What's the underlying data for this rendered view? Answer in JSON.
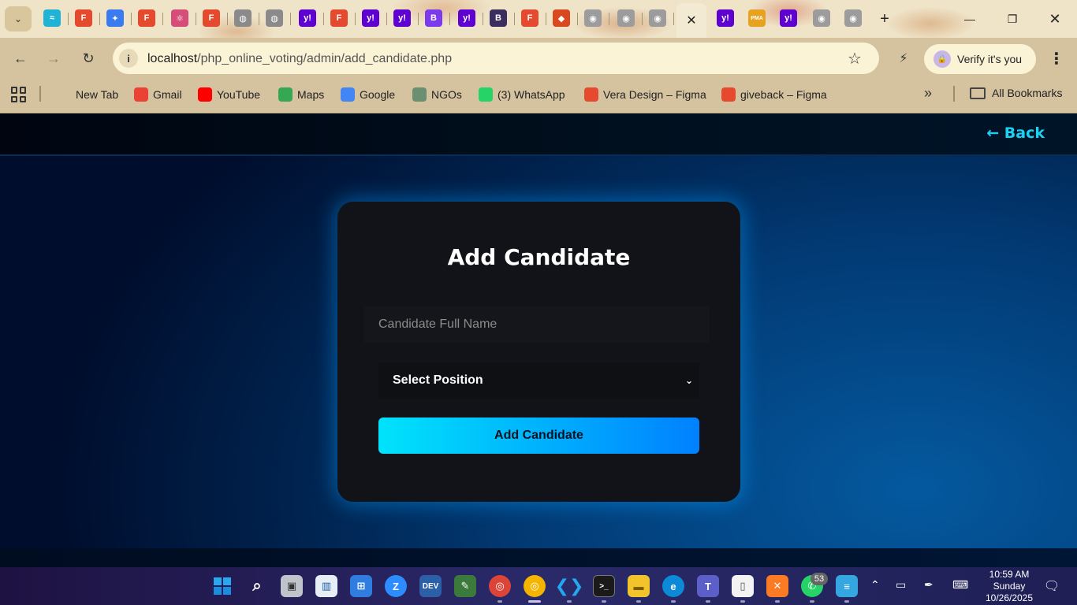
{
  "browser": {
    "pinned_tabs": [
      {
        "icon": "tailwind-icon",
        "glyph": "≈",
        "color": "#21b3d6"
      },
      {
        "icon": "figma-icon",
        "glyph": "F",
        "color": "#e64a2e"
      },
      {
        "icon": "gemini-icon",
        "glyph": "✦",
        "color": "#3a7bf0"
      },
      {
        "icon": "figma-icon",
        "glyph": "F",
        "color": "#e64a2e"
      },
      {
        "icon": "react-icon",
        "glyph": "⚛",
        "color": "#d64d7a"
      },
      {
        "icon": "figma-icon",
        "glyph": "F",
        "color": "#e64a2e"
      },
      {
        "icon": "globe-icon",
        "glyph": "◍",
        "color": "#8a8a8a"
      },
      {
        "icon": "globe-icon",
        "glyph": "◍",
        "color": "#8a8a8a"
      },
      {
        "icon": "yahoo-icon",
        "glyph": "y!",
        "color": "#5f01d1"
      },
      {
        "icon": "figma-icon",
        "glyph": "F",
        "color": "#e64a2e"
      },
      {
        "icon": "yahoo-icon",
        "glyph": "y!",
        "color": "#5f01d1"
      },
      {
        "icon": "yahoo-icon",
        "glyph": "y!",
        "color": "#5f01d1"
      },
      {
        "icon": "bootstrap-icon",
        "glyph": "B",
        "color": "#7c3aed"
      },
      {
        "icon": "yahoo-icon",
        "glyph": "y!",
        "color": "#5f01d1"
      },
      {
        "icon": "bootstrap-icon",
        "glyph": "B",
        "color": "#3b2d5e"
      },
      {
        "icon": "figma-icon",
        "glyph": "F",
        "color": "#e64a2e"
      },
      {
        "icon": "brave-icon",
        "glyph": "◆",
        "color": "#d9481f"
      },
      {
        "icon": "github-icon",
        "glyph": "◉",
        "color": "#9c9c9c"
      },
      {
        "icon": "github-icon",
        "glyph": "◉",
        "color": "#9c9c9c"
      },
      {
        "icon": "github-icon",
        "glyph": "◉",
        "color": "#9c9c9c"
      }
    ],
    "after_tabs": [
      {
        "icon": "yahoo-icon",
        "glyph": "y!",
        "color": "#5f01d1"
      },
      {
        "icon": "phpmyadmin-icon",
        "glyph": "PMA",
        "color": "#e7a320"
      },
      {
        "icon": "yahoo-icon",
        "glyph": "y!",
        "color": "#5f01d1"
      },
      {
        "icon": "github-icon",
        "glyph": "◉",
        "color": "#9c9c9c"
      },
      {
        "icon": "github-icon",
        "glyph": "◉",
        "color": "#9c9c9c"
      }
    ],
    "url_host": "localhost",
    "url_path": "/php_online_voting/admin/add_candidate.php",
    "profile_label": "Verify it's you",
    "bookmarks": [
      {
        "label": "New Tab",
        "icon": "none",
        "color": ""
      },
      {
        "label": "Gmail",
        "icon": "gmail-icon",
        "color": "#ea4335"
      },
      {
        "label": "YouTube",
        "icon": "youtube-icon",
        "color": "#ff0000"
      },
      {
        "label": "Maps",
        "icon": "maps-icon",
        "color": "#34a853"
      },
      {
        "label": "Google",
        "icon": "google-icon",
        "color": "#4285f4"
      },
      {
        "label": "NGOs",
        "icon": "heart-icon",
        "color": "#6b8f71"
      },
      {
        "label": "(3) WhatsApp",
        "icon": "whatsapp-icon",
        "color": "#25d366"
      },
      {
        "label": "Vera Design – Figma",
        "icon": "figma-icon",
        "color": "#e64a2e"
      },
      {
        "label": "giveback – Figma",
        "icon": "figma-icon",
        "color": "#e64a2e"
      }
    ],
    "all_bookmarks_label": "All Bookmarks"
  },
  "page": {
    "back_label": "← Back",
    "form_title": "Add Candidate",
    "name_placeholder": "Candidate Full Name",
    "name_value": "",
    "position_selected": "Select Position",
    "submit_label": "Add Candidate",
    "accent_color": "#19d3f5"
  },
  "taskbar": {
    "time": "10:59 AM",
    "day": "Sunday",
    "date": "10/26/2025",
    "whatsapp_badge": "53"
  }
}
